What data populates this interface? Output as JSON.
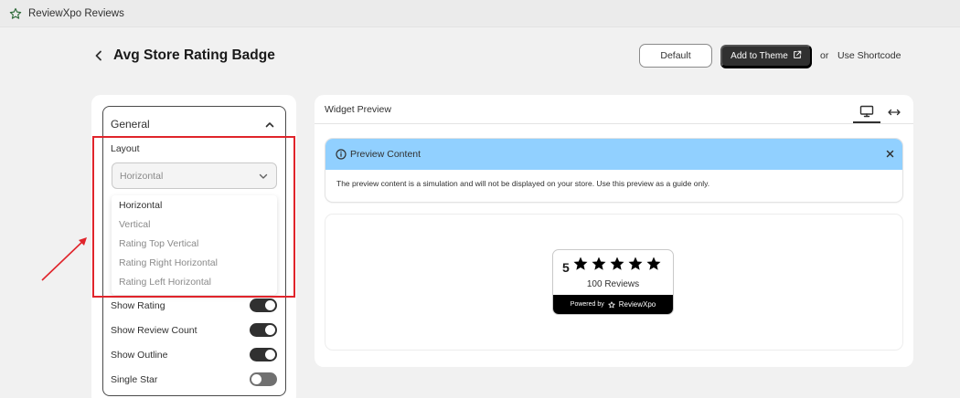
{
  "app": {
    "name": "ReviewXpo Reviews",
    "icon": "star-icon"
  },
  "header": {
    "title": "Avg Store Rating Badge",
    "default_label": "Default",
    "add_theme_label": "Add to Theme",
    "or_text": "or",
    "shortcode_label": "Use Shortcode"
  },
  "settings": {
    "section_title": "General",
    "layout_label": "Layout",
    "layout_value": "Horizontal",
    "layout_options": [
      "Horizontal",
      "Vertical",
      "Rating Top Vertical",
      "Rating Right Horizontal",
      "Rating Left Horizontal"
    ],
    "toggles": [
      {
        "label": "Show Rating",
        "on": true
      },
      {
        "label": "Show Review Count",
        "on": true
      },
      {
        "label": "Show Outline",
        "on": true
      },
      {
        "label": "Single Star",
        "on": false
      }
    ]
  },
  "preview": {
    "title": "Widget Preview",
    "banner_title": "Preview Content",
    "banner_text": "The preview content is a simulation and will not be displayed on your store. Use this preview as a guide only.",
    "badge": {
      "rating": "5",
      "stars": 5,
      "count_text": "100 Reviews",
      "powered_by": "Powered by",
      "brand": "ReviewXpo"
    }
  },
  "colors": {
    "accent_dark": "#303030",
    "banner_blue": "#91d0ff",
    "annotation_red": "#e0242b"
  }
}
